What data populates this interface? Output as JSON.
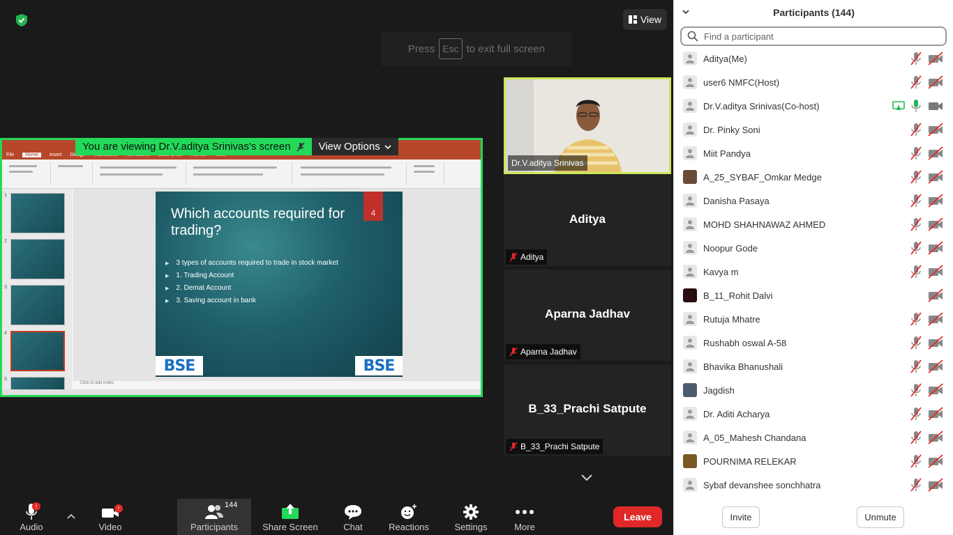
{
  "top": {
    "view_label": "View",
    "esc_press": "Press",
    "esc_key": "Esc",
    "esc_suffix": "to exit full screen"
  },
  "share": {
    "viewing_text": "You are viewing Dr.V.aditya Srinivas's screen",
    "view_options_label": "View Options",
    "ppt_tabs": [
      "File",
      "Home",
      "Insert",
      "Design",
      "Transitions",
      "Animations",
      "Slide Show",
      "Review",
      "View"
    ],
    "slide": {
      "title": "Which accounts required for trading?",
      "number": "4",
      "bullets": [
        "3 types of accounts required to trade in stock market",
        "1. Trading Account",
        "2. Demat Account",
        "3. Saving account in bank"
      ],
      "logo_text": "BSE"
    },
    "thumbnails": [
      "1",
      "2",
      "3",
      "4",
      "5"
    ],
    "notes_placeholder": "Click to add notes"
  },
  "tiles": [
    {
      "name": "Dr.V.aditya Srinivas",
      "big": "",
      "muted": false
    },
    {
      "name": "Aditya",
      "big": "Aditya",
      "muted": true
    },
    {
      "name": "Aparna Jadhav",
      "big": "Aparna Jadhav",
      "muted": true
    },
    {
      "name": "B_33_Prachi Satpute",
      "big": "B_33_Prachi Satpute",
      "muted": true
    }
  ],
  "toolbar": {
    "audio": "Audio",
    "video": "Video",
    "participants": "Participants",
    "participants_count": "144",
    "share": "Share Screen",
    "chat": "Chat",
    "reactions": "Reactions",
    "settings": "Settings",
    "more": "More",
    "leave": "Leave",
    "audio_badge": "!",
    "video_badge": "!"
  },
  "panel": {
    "title": "Participants (144)",
    "search_placeholder": "Find a participant",
    "invite": "Invite",
    "unmute": "Unmute",
    "participants": [
      {
        "name": "Aditya(Me)",
        "avatar": "default",
        "mic": "muted",
        "video": "off"
      },
      {
        "name": "user6 NMFC(Host)",
        "avatar": "default",
        "mic": "muted",
        "video": "off"
      },
      {
        "name": "Dr.V.aditya Srinivas(Co-host)",
        "avatar": "default",
        "mic": "on",
        "video": "on",
        "sharing": true
      },
      {
        "name": "Dr. Pinky Soni",
        "avatar": "default",
        "mic": "muted",
        "video": "off"
      },
      {
        "name": "Miit Pandya",
        "avatar": "default",
        "mic": "muted",
        "video": "off"
      },
      {
        "name": "A_25_SYBAF_Omkar Medge",
        "avatar": "photo",
        "mic": "muted",
        "video": "off"
      },
      {
        "name": "Danisha Pasaya",
        "avatar": "default",
        "mic": "muted",
        "video": "off"
      },
      {
        "name": "MOHD SHAHNAWAZ AHMED",
        "avatar": "default",
        "mic": "muted",
        "video": "off"
      },
      {
        "name": "Noopur Gode",
        "avatar": "default",
        "mic": "muted",
        "video": "off"
      },
      {
        "name": "Kavya m",
        "avatar": "default",
        "mic": "muted",
        "video": "off"
      },
      {
        "name": "B_11_Rohit Dalvi",
        "avatar": "photo",
        "mic": "none",
        "video": "off"
      },
      {
        "name": "Rutuja Mhatre",
        "avatar": "default",
        "mic": "muted",
        "video": "off"
      },
      {
        "name": "Rushabh oswal A-58",
        "avatar": "default",
        "mic": "muted",
        "video": "off"
      },
      {
        "name": "Bhavika Bhanushali",
        "avatar": "default",
        "mic": "muted",
        "video": "off"
      },
      {
        "name": "Jagdish",
        "avatar": "photo",
        "mic": "muted",
        "video": "off"
      },
      {
        "name": "Dr. Aditi Acharya",
        "avatar": "default",
        "mic": "muted",
        "video": "off"
      },
      {
        "name": "A_05_Mahesh Chandana",
        "avatar": "default",
        "mic": "muted",
        "video": "off"
      },
      {
        "name": "POURNIMA RELEKAR",
        "avatar": "photo",
        "mic": "muted",
        "video": "off"
      },
      {
        "name": "Sybaf devanshee sonchhatra",
        "avatar": "default",
        "mic": "muted",
        "video": "off"
      }
    ]
  },
  "colors": {
    "share_border": "#23d959",
    "active_speaker": "#c9e85a",
    "leave": "#e02828",
    "muted_icon": "#e02828"
  }
}
